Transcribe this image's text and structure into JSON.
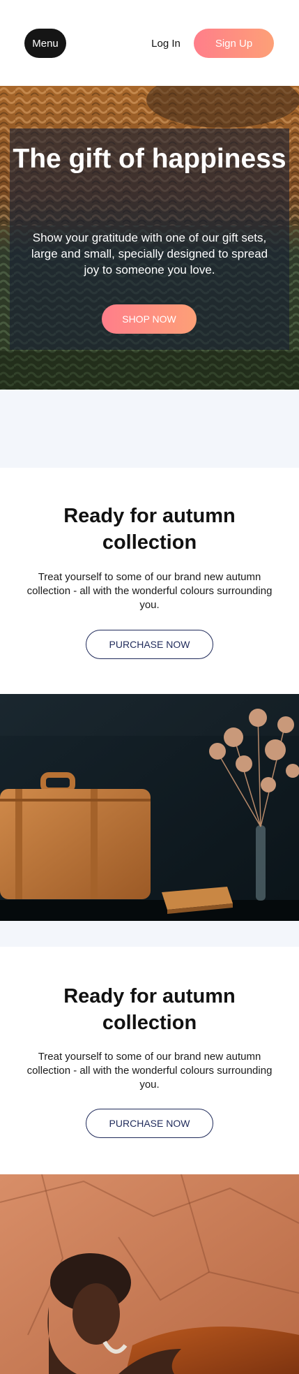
{
  "header": {
    "menu_label": "Menu",
    "login_label": "Log In",
    "signup_label": "Sign Up"
  },
  "hero": {
    "title": "The gift of happiness",
    "text": "Show your gratitude with one of our gift sets, large and small, specially designed to spread joy to someone you love.",
    "button_label": "SHOP NOW"
  },
  "sections": [
    {
      "title": "Ready for autumn collection",
      "text": "Treat yourself to some of our brand new autumn collection - all with the wonderful colours surrounding you.",
      "button_label": "PURCHASE NOW"
    },
    {
      "title": "Ready for autumn collection",
      "text": "Treat yourself to some of our brand new autumn collection - all with the wonderful colours surrounding you.",
      "button_label": "PURCHASE NOW"
    }
  ],
  "colors": {
    "accent_gradient_start": "#ff7e8a",
    "accent_gradient_end": "#fda077",
    "outline_button": "#1f2a5a",
    "band_background": "#f3f6fb",
    "dark_button": "#151515"
  },
  "icons": []
}
